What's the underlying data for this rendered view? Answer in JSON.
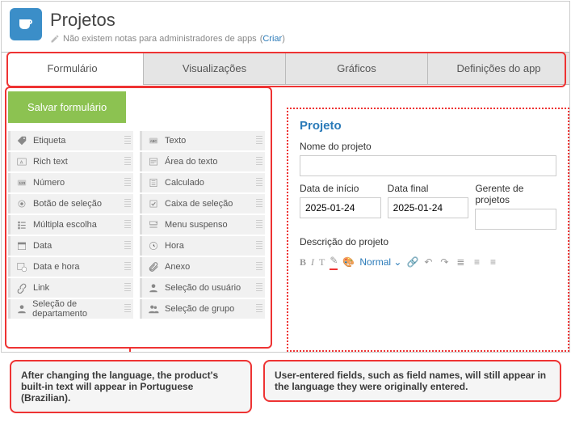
{
  "header": {
    "title": "Projetos",
    "subtitle_text": "Não existem notas para administradores de apps",
    "subtitle_link_prefix": "(",
    "subtitle_link": "Criar",
    "subtitle_link_suffix": ")"
  },
  "tabs": [
    {
      "label": "Formulário",
      "active": true
    },
    {
      "label": "Visualizações",
      "active": false
    },
    {
      "label": "Gráficos",
      "active": false
    },
    {
      "label": "Definições do app",
      "active": false
    }
  ],
  "save_button": "Salvar formulário",
  "palette_left": [
    {
      "label": "Etiqueta",
      "icon": "tag"
    },
    {
      "label": "Rich text",
      "icon": "richtext"
    },
    {
      "label": "Número",
      "icon": "number"
    },
    {
      "label": "Botão de seleção",
      "icon": "radio"
    },
    {
      "label": "Múltipla escolha",
      "icon": "checklist"
    },
    {
      "label": "Data",
      "icon": "calendar"
    },
    {
      "label": "Data e hora",
      "icon": "calendarclock"
    },
    {
      "label": "Link",
      "icon": "link"
    },
    {
      "label": "Seleção de departamento",
      "icon": "user"
    }
  ],
  "palette_right": [
    {
      "label": "Texto",
      "icon": "text"
    },
    {
      "label": "Área do texto",
      "icon": "textarea"
    },
    {
      "label": "Calculado",
      "icon": "calc"
    },
    {
      "label": "Caixa de seleção",
      "icon": "checkbox"
    },
    {
      "label": "Menu suspenso",
      "icon": "dropdown"
    },
    {
      "label": "Hora",
      "icon": "clock"
    },
    {
      "label": "Anexo",
      "icon": "attachment"
    },
    {
      "label": "Seleção do usuário",
      "icon": "user"
    },
    {
      "label": "Seleção de grupo",
      "icon": "users"
    }
  ],
  "form": {
    "title": "Projeto",
    "fields": {
      "project_name_label": "Nome do projeto",
      "start_date_label": "Data de início",
      "start_date_value": "2025-01-24",
      "end_date_label": "Data final",
      "end_date_value": "2025-01-24",
      "manager_label": "Gerente de projetos",
      "description_label": "Descrição do projeto"
    },
    "richtext": {
      "normal": "Normal"
    }
  },
  "callouts": {
    "left": "After changing the language, the product's built-in text will appear in Portuguese (Brazilian).",
    "right": "User-entered fields, such as field names, will still appear in the language they were originally entered."
  }
}
